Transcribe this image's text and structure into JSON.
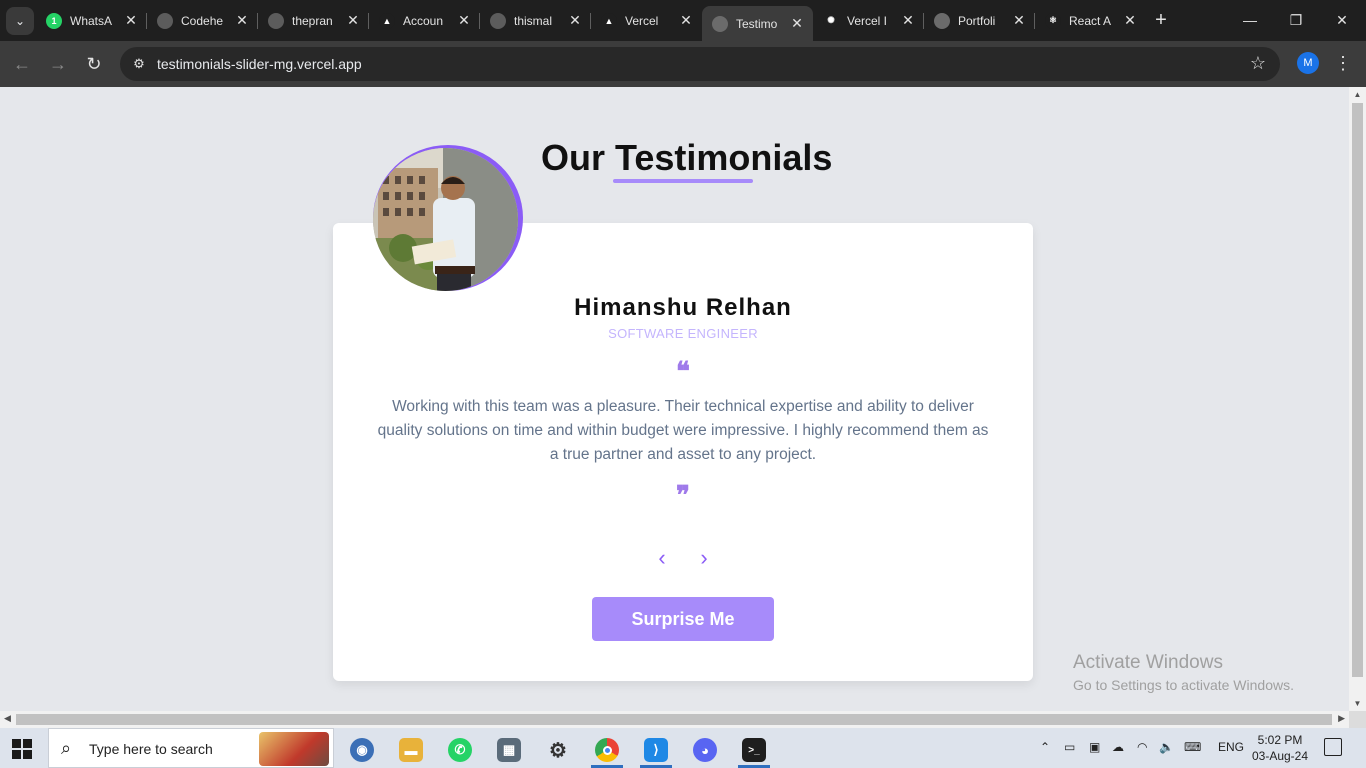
{
  "browser": {
    "tabs": [
      {
        "label": "WhatsA",
        "favicon": "whatsapp-icon",
        "color": "#25d366",
        "glyph": "1"
      },
      {
        "label": "Codehe",
        "favicon": "github-icon",
        "color": "#5c5c5c",
        "glyph": ""
      },
      {
        "label": "thepran",
        "favicon": "github-icon",
        "color": "#5c5c5c",
        "glyph": ""
      },
      {
        "label": "Accoun",
        "favicon": "vercel-icon",
        "color": "#1f1f1f",
        "glyph": "▲"
      },
      {
        "label": "thismal",
        "favicon": "github-icon",
        "color": "#5c5c5c",
        "glyph": ""
      },
      {
        "label": "Vercel",
        "favicon": "vercel-icon",
        "color": "#1f1f1f",
        "glyph": "▲"
      },
      {
        "label": "Testimo",
        "favicon": "globe-icon",
        "color": "#6b6b6b",
        "glyph": "",
        "active": true
      },
      {
        "label": "Vercel I",
        "favicon": "chatgpt-icon",
        "color": "#1f1f1f",
        "glyph": "✺"
      },
      {
        "label": "Portfoli",
        "favicon": "globe-icon",
        "color": "#6b6b6b",
        "glyph": ""
      },
      {
        "label": "React A",
        "favicon": "react-icon",
        "color": "#1f1f1f",
        "glyph": "⚛"
      }
    ],
    "url": "testimonials-slider-mg.vercel.app",
    "profile_initial": "M"
  },
  "page": {
    "heading": "Our Testimonials",
    "testimonial": {
      "name": "Himanshu Relhan",
      "role": "SOFTWARE ENGINEER",
      "open_quote": "❝",
      "close_quote": "❞",
      "text": "Working with this team was a pleasure. Their technical expertise and ability to deliver quality solutions on time and within budget were impressive. I highly recommend them as a true partner and asset to any project."
    },
    "prev_label": "‹",
    "next_label": "›",
    "surprise_label": "Surprise Me"
  },
  "watermark": {
    "title": "Activate Windows",
    "subtitle": "Go to Settings to activate Windows."
  },
  "taskbar": {
    "search_placeholder": "Type here to search",
    "language": "ENG",
    "time": "5:02 PM",
    "date": "03-Aug-24"
  },
  "colors": {
    "accent": "#a78bfa",
    "accent_dark": "#8b5cf6",
    "page_bg": "#e5e7eb"
  }
}
